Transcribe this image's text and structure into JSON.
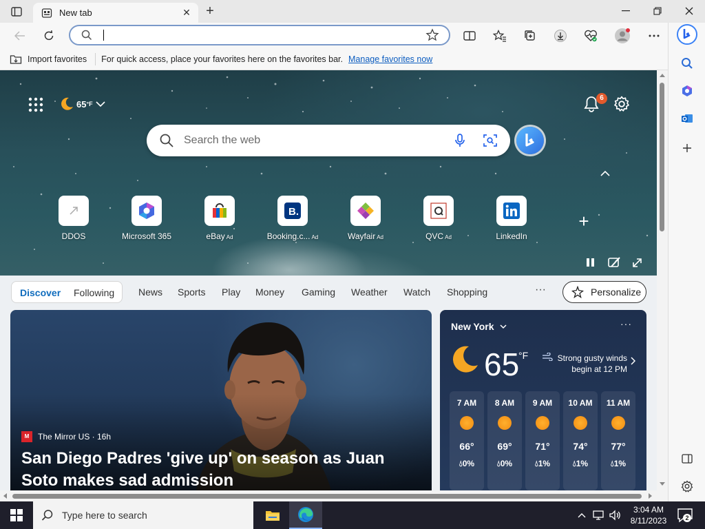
{
  "window": {
    "tab_title": "New tab",
    "new_tab_symbol": "+"
  },
  "toolbar": {
    "address_value": "",
    "address_placeholder": ""
  },
  "favorites_bar": {
    "import_label": "Import favorites",
    "message": "For quick access, place your favorites here on the favorites bar.",
    "manage_link": "Manage favorites now"
  },
  "hero": {
    "weather_temp": "65",
    "weather_unit": "°F",
    "notification_count": "6",
    "search_placeholder": "Search the web",
    "tiles": [
      {
        "label": "DDOS",
        "ad": ""
      },
      {
        "label": "Microsoft 365",
        "ad": ""
      },
      {
        "label": "eBay",
        "ad": "Ad"
      },
      {
        "label": "Booking.c...",
        "ad": "Ad"
      },
      {
        "label": "Wayfair",
        "ad": "Ad"
      },
      {
        "label": "QVC",
        "ad": "Ad"
      },
      {
        "label": "LinkedIn",
        "ad": ""
      }
    ]
  },
  "feed_nav": {
    "discover": "Discover",
    "following": "Following",
    "items": [
      "News",
      "Sports",
      "Play",
      "Money",
      "Gaming",
      "Weather",
      "Watch",
      "Shopping"
    ],
    "more": "···",
    "personalize": "Personalize"
  },
  "news_card": {
    "source": "The Mirror US · 16h",
    "headline": "San Diego Padres 'give up' on season as Juan Soto makes sad admission"
  },
  "weather_card": {
    "city": "New York",
    "more": "···",
    "temp": "65",
    "unit": "°F",
    "alert": "Strong gusty winds begin at 12 PM",
    "hours": [
      {
        "time": "7 AM",
        "temp": "66°",
        "precip": "0%"
      },
      {
        "time": "8 AM",
        "temp": "69°",
        "precip": "0%"
      },
      {
        "time": "9 AM",
        "temp": "71°",
        "precip": "1%"
      },
      {
        "time": "10 AM",
        "temp": "74°",
        "precip": "1%"
      },
      {
        "time": "11 AM",
        "temp": "77°",
        "precip": "1%"
      }
    ]
  },
  "taskbar": {
    "search_placeholder": "Type here to search",
    "time": "3:04 AM",
    "date": "8/11/2023",
    "notification_count": "2"
  },
  "colors": {
    "accent": "#0f6cbd",
    "taskbar": "#1f1f2b",
    "badge": "#e25a2c"
  }
}
